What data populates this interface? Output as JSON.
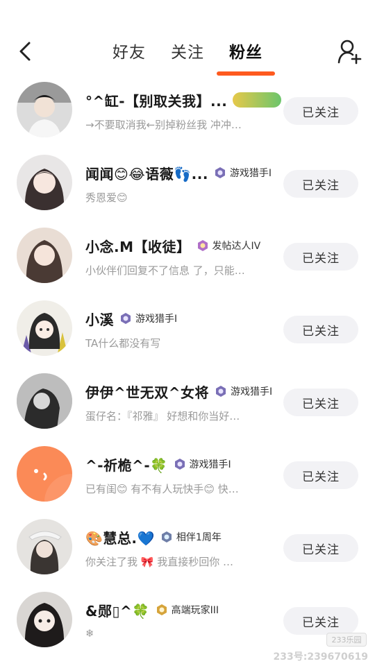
{
  "header": {
    "tabs": [
      {
        "label": "好友"
      },
      {
        "label": "关注"
      },
      {
        "label": "粉丝"
      }
    ],
    "active_tab": "粉丝"
  },
  "followers": [
    {
      "name": "°^缸-【别取关我】...",
      "badge": "",
      "level_tag": true,
      "sub": "→不要取消我←别掉粉丝我 冲冲…",
      "button": "已关注"
    },
    {
      "name": "闻闻😊😂语薇👣...",
      "badge": "游戏猎手I",
      "sub": "秀恩爱😊",
      "button": "已关注"
    },
    {
      "name": "小念.M【收徒】",
      "badge": "发帖达人IV",
      "sub": "小伙伴们回复不了信息 了，只能…",
      "button": "已关注"
    },
    {
      "name": "小溪",
      "badge": "游戏猎手I",
      "sub": "TA什么都没有写",
      "button": "已关注"
    },
    {
      "name": "伊伊^世无双^女将",
      "badge": "游戏猎手I",
      "sub": "蛋仔名：『祁雅』 好想和你当好…",
      "button": "已关注"
    },
    {
      "name": "^-祈桅^-🍀",
      "badge": "游戏猎手I",
      "sub": "已有闺😊 有不有人玩快手😊 快…",
      "button": "已关注"
    },
    {
      "name": "🎨慧总.💙",
      "badge": "相伴1周年",
      "sub": "你关注了我 🎀 我直接秒回你 …",
      "button": "已关注"
    },
    {
      "name": "&郧▯^🍀",
      "badge": "高端玩家III",
      "sub": "❄",
      "button": "已关注"
    }
  ],
  "watermark": {
    "box_text": "233乐园",
    "id_text": "233号:239670619"
  },
  "colors": {
    "accent": "#fe5a1e",
    "button_bg": "#f2f2f5",
    "sub_text": "#9a9a9a"
  }
}
